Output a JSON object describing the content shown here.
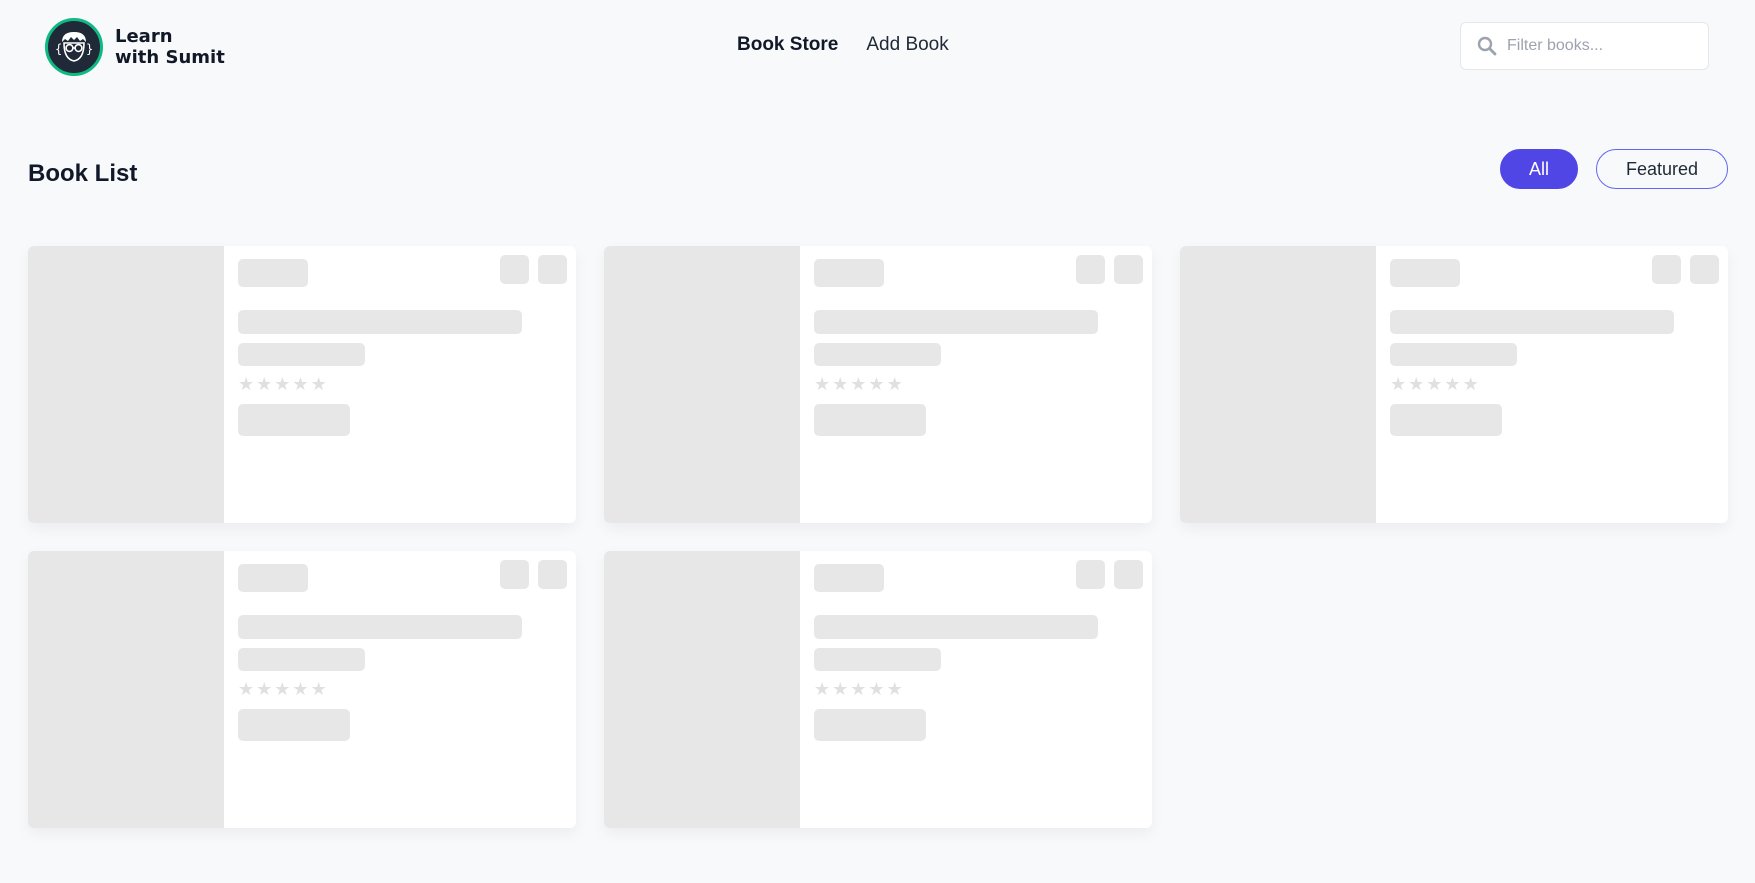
{
  "brand": {
    "line1": "Learn",
    "line2": "with Sumit"
  },
  "nav": {
    "links": [
      {
        "label": "Book Store",
        "active": true
      },
      {
        "label": "Add Book",
        "active": false
      }
    ]
  },
  "search": {
    "placeholder": "Filter books...",
    "value": ""
  },
  "main": {
    "title": "Book List",
    "filters": [
      {
        "label": "All",
        "active": true
      },
      {
        "label": "Featured",
        "active": false
      }
    ],
    "cards_loading": 5
  },
  "colors": {
    "accent": "#4f46e5",
    "logo_ring": "#10b981",
    "skeleton": "#e7e7e7",
    "background": "#f8f9fb"
  },
  "icons": {
    "search": "search-icon",
    "star": "star-icon",
    "logo": "avatar-logo-icon"
  }
}
